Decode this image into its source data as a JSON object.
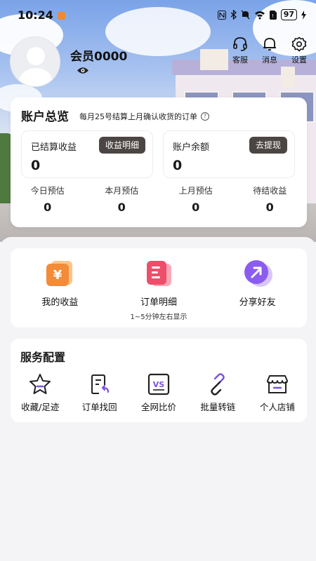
{
  "status_bar": {
    "time": "10:24",
    "battery": "97"
  },
  "profile": {
    "username": "会员0000"
  },
  "top_actions": [
    {
      "label": "客服",
      "icon": "headset-icon"
    },
    {
      "label": "消息",
      "icon": "bell-icon"
    },
    {
      "label": "设置",
      "icon": "gear-icon"
    }
  ],
  "account": {
    "title": "账户总览",
    "subtitle": "每月25号结算上月确认收货的订单",
    "settled": {
      "label": "已结算收益",
      "value": "0",
      "button": "收益明细"
    },
    "balance": {
      "label": "账户余额",
      "value": "0",
      "button": "去提现"
    },
    "stats": [
      {
        "label": "今日预估",
        "value": "0"
      },
      {
        "label": "本月预估",
        "value": "0"
      },
      {
        "label": "上月预估",
        "value": "0"
      },
      {
        "label": "待结收益",
        "value": "0"
      }
    ]
  },
  "quick": [
    {
      "label": "我的收益",
      "sub": "",
      "icon": "yen-icon"
    },
    {
      "label": "订单明细",
      "sub": "1~5分钟左右显示",
      "icon": "order-list-icon"
    },
    {
      "label": "分享好友",
      "sub": "",
      "icon": "share-arrow-icon"
    }
  ],
  "services": {
    "title": "服务配置",
    "items": [
      {
        "label": "收藏/足迹",
        "icon": "star-icon"
      },
      {
        "label": "订单找回",
        "icon": "order-retrieve-icon"
      },
      {
        "label": "全网比价",
        "icon": "vs-icon"
      },
      {
        "label": "批量转链",
        "icon": "link-icon"
      },
      {
        "label": "个人店铺",
        "icon": "store-icon"
      }
    ]
  },
  "colors": {
    "dark_button": "#4b4644",
    "orange": "#f28c38",
    "pink": "#ee4e6a",
    "purple": "#8c5cf0"
  }
}
